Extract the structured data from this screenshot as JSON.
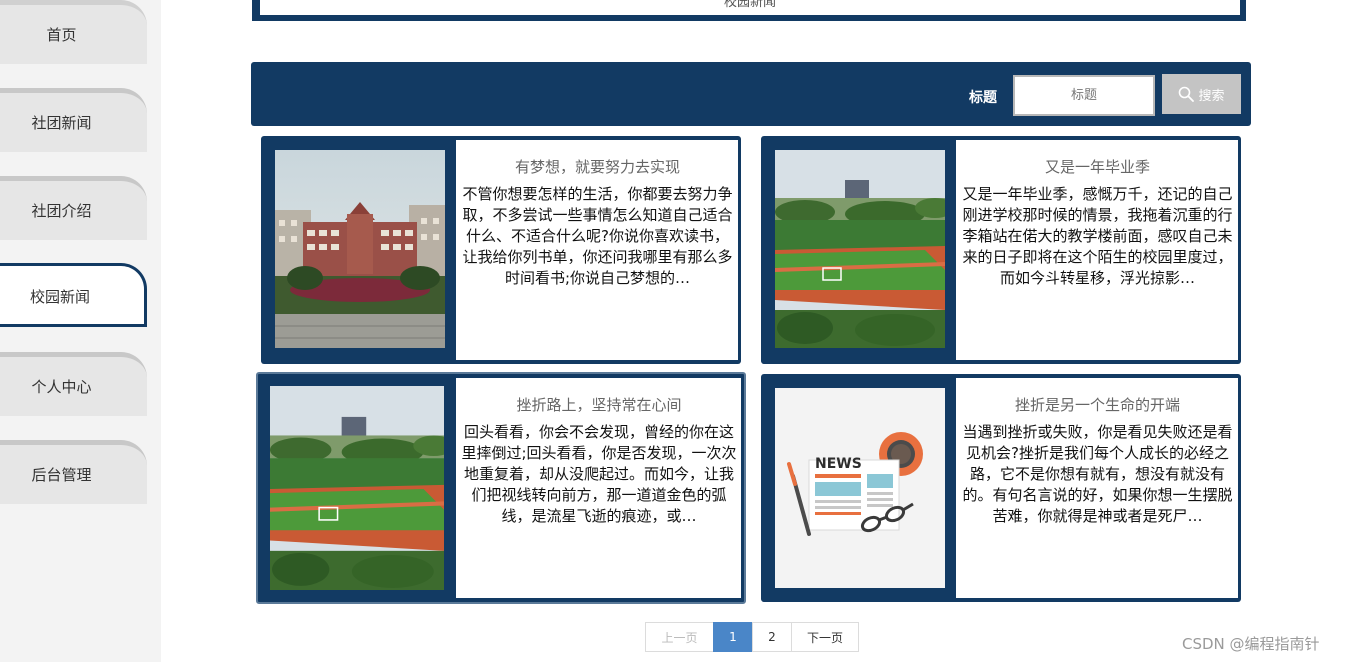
{
  "sidebar": {
    "items": [
      {
        "label": "首页",
        "active": false
      },
      {
        "label": "社团新闻",
        "active": false
      },
      {
        "label": "社团介绍",
        "active": false
      },
      {
        "label": "校园新闻",
        "active": true
      },
      {
        "label": "个人中心",
        "active": false
      },
      {
        "label": "后台管理",
        "active": false
      }
    ]
  },
  "top_frame": {
    "text": "校园新闻"
  },
  "search": {
    "label": "标题",
    "placeholder": "标题",
    "button_label": "搜索",
    "icon": "search-icon"
  },
  "news": [
    {
      "title": "有梦想，就要努力去实现",
      "excerpt": "不管你想要怎样的生活，你都要去努力争取，不多尝试一些事情怎么知道自己适合什么、不适合什么呢?你说你喜欢读书，让我给你列书单，你还问我哪里有那么多时间看书;你说自己梦想的…",
      "image": "school-building"
    },
    {
      "title": "又是一年毕业季",
      "excerpt": "又是一年毕业季，感慨万千，还记的自己刚进学校那时候的情景，我拖着沉重的行李箱站在偌大的教学楼前面，感叹自己未来的日子即将在这个陌生的校园里度过，而如今斗转星移，浮光掠影…",
      "image": "sports-field"
    },
    {
      "title": "挫折路上，坚持常在心间",
      "excerpt": "回头看看，你会不会发现，曾经的你在这里摔倒过;回头看看，你是否发现，一次次地重复着，却从没爬起过。而如今，让我们把视线转向前方，那一道道金色的弧线，是流星飞逝的痕迹，或…",
      "image": "sports-field"
    },
    {
      "title": "挫折是另一个生命的开端",
      "excerpt": "当遇到挫折或失败，你是看见失败还是看见机会?挫折是我们每个人成长的必经之路，它不是你想有就有，想没有就没有的。有句名言说的好，如果你想一生摆脱苦难，你就得是神或者是死尸…",
      "image": "news-illustration",
      "image_text": "NEWS"
    }
  ],
  "pagination": {
    "prev": "上一页",
    "pages": [
      "1",
      "2"
    ],
    "current": "1",
    "next": "下一页"
  },
  "watermark": "CSDN @编程指南针",
  "colors": {
    "primary": "#123a63",
    "sidebar_bg": "#f3f3f3",
    "tab_bg": "#e6e6e6",
    "page_active": "#4a86c8",
    "search_button": "#c4c4c4"
  }
}
